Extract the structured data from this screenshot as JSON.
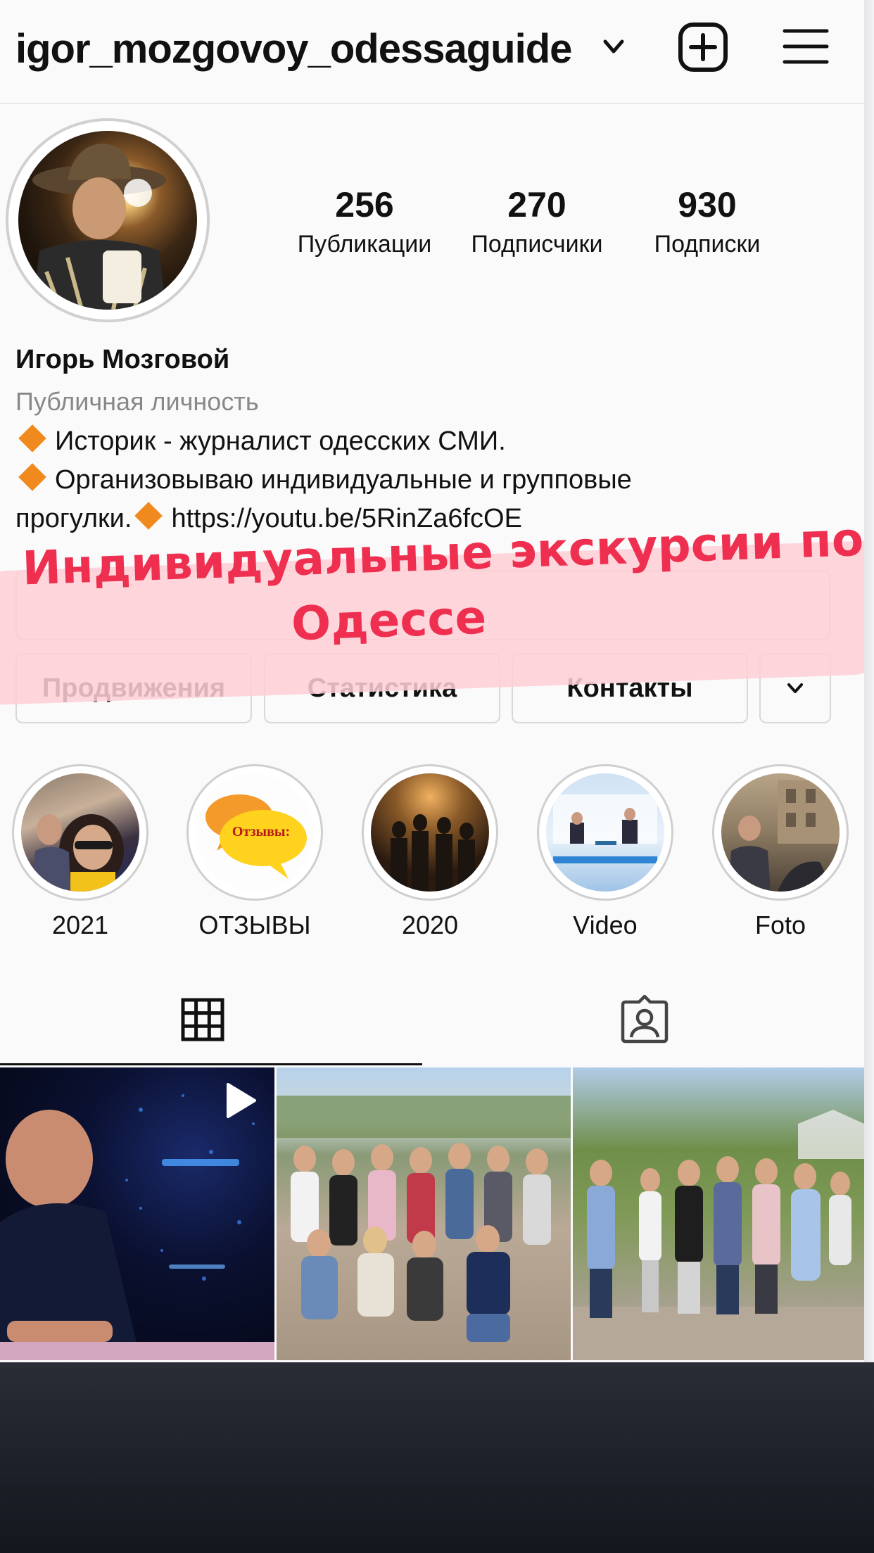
{
  "header": {
    "username": "igor_mozgovoy_odessaguide"
  },
  "profile": {
    "stats": [
      {
        "value": "256",
        "label": "Публикации"
      },
      {
        "value": "270",
        "label": "Подписчики"
      },
      {
        "value": "930",
        "label": "Подписки"
      }
    ],
    "name": "Игорь Мозговой",
    "category": "Публичная личность",
    "bio_line1": "Историк - журналист одесских СМИ.",
    "bio_line2": "Организовываю индивидуальные и групповые",
    "bio_line3": "прогулки.",
    "bio_link": "https://youtu.be/5RinZa6fcOE"
  },
  "buttons": {
    "promotions": "Продвижения",
    "insights": "Статистика",
    "contacts": "Контакты"
  },
  "overlay": {
    "line1": "Индивидуальные экскурсии по",
    "line2": "Одессе"
  },
  "highlights": [
    {
      "label": "2021"
    },
    {
      "label": "ОТЗЫВЫ",
      "bubble_text": "Отзывы:"
    },
    {
      "label": "2020"
    },
    {
      "label": "Video"
    },
    {
      "label": "Foto"
    }
  ],
  "colors": {
    "accent_text": "#ee2f4f",
    "sticker_bg": "#ffced6",
    "diamond": "#f08a1e"
  },
  "icons": [
    "chevron-down-icon",
    "new-post-icon",
    "hamburger-menu-icon",
    "grid-icon",
    "tagged-icon",
    "play-icon",
    "orange-diamond-icon"
  ]
}
